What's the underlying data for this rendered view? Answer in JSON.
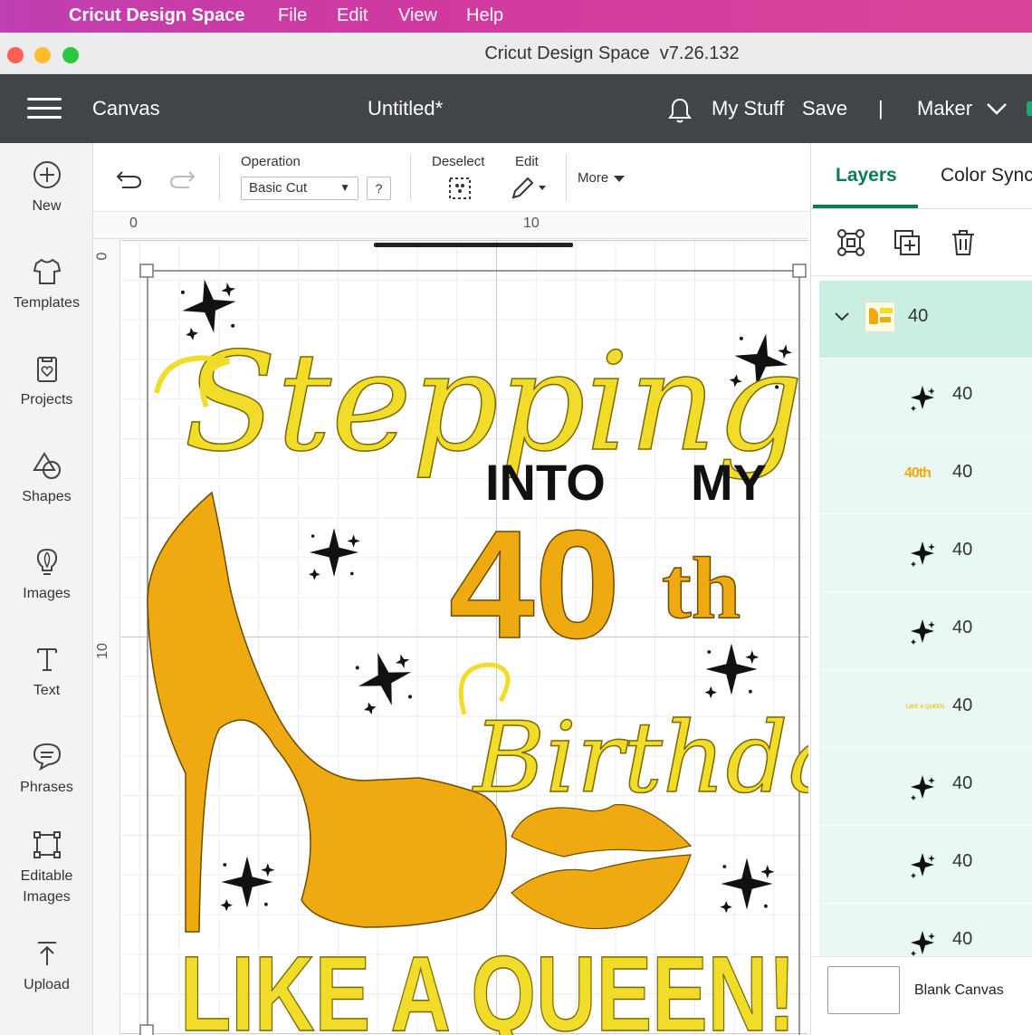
{
  "mac_menubar": {
    "app_name": "Cricut Design Space",
    "items": [
      "File",
      "Edit",
      "View",
      "Help"
    ]
  },
  "window": {
    "title": "Cricut Design Space  v7.26.132"
  },
  "header": {
    "menu_icon": "hamburger-icon",
    "canvas_label": "Canvas",
    "project_title": "Untitled*",
    "notification_icon": "bell-icon",
    "my_stuff": "My Stuff",
    "save": "Save",
    "separator": "|",
    "machine": "Maker"
  },
  "sidebar": {
    "items": [
      {
        "label": "New",
        "icon": "plus-circle-icon"
      },
      {
        "label": "Templates",
        "icon": "shirt-icon"
      },
      {
        "label": "Projects",
        "icon": "projects-icon"
      },
      {
        "label": "Shapes",
        "icon": "shapes-icon"
      },
      {
        "label": "Images",
        "icon": "lightbulb-icon"
      },
      {
        "label": "Text",
        "icon": "text-icon"
      },
      {
        "label": "Phrases",
        "icon": "speech-bubble-icon"
      },
      {
        "label": "Editable\nImages",
        "icon": "editable-image-icon"
      },
      {
        "label": "Upload",
        "icon": "upload-icon"
      }
    ]
  },
  "toolbar": {
    "undo_icon": "undo-icon",
    "redo_icon": "redo-icon",
    "operation_label": "Operation",
    "operation_value": "Basic Cut",
    "help_label": "?",
    "deselect_label": "Deselect",
    "edit_label": "Edit",
    "more_label": "More"
  },
  "canvas": {
    "ruler_top": [
      "0",
      "10"
    ],
    "ruler_left": [
      "0",
      "10"
    ],
    "design_text": {
      "line1": "Stepping",
      "line2a": "INTO",
      "line2b": "MY",
      "line3a": "40",
      "line3b": "th",
      "line4": "Birthday",
      "line5": "LIKE A QUEEN!"
    },
    "colors": {
      "yellow": "#f2dc2a",
      "gold": "#eeaa10",
      "black": "#111111"
    }
  },
  "layers_panel": {
    "tabs": [
      "Layers",
      "Color Sync"
    ],
    "actions": [
      "group-icon",
      "duplicate-icon",
      "delete-icon"
    ],
    "group": {
      "name": "40",
      "expand_icon": "chevron-down-icon"
    },
    "children": [
      {
        "name": "40",
        "thumb": "sparkle-icon"
      },
      {
        "name": "40",
        "thumb": "40th-text-thumb",
        "thumb_text": "40th"
      },
      {
        "name": "40",
        "thumb": "sparkle-icon"
      },
      {
        "name": "40",
        "thumb": "sparkle-icon"
      },
      {
        "name": "40",
        "thumb": "like-a-queen-thumb",
        "thumb_text": "LIKE A QUEEN"
      },
      {
        "name": "40",
        "thumb": "sparkle-icon"
      },
      {
        "name": "40",
        "thumb": "sparkle-icon"
      },
      {
        "name": "40",
        "thumb": "sparkle-icon"
      }
    ],
    "blank_canvas": "Blank Canvas"
  }
}
